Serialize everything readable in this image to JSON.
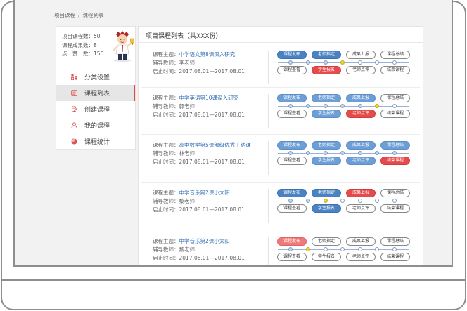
{
  "breadcrumb": [
    "项目课程",
    "课程列表"
  ],
  "stats": {
    "project_courses": "项目课程数：50",
    "results": "课程成果数：8",
    "likes": "点　赞　数：156"
  },
  "menu": [
    {
      "label": "分类设置",
      "icon": "category-icon",
      "active": false
    },
    {
      "label": "课程列表",
      "icon": "list-icon",
      "active": true
    },
    {
      "label": "创建课程",
      "icon": "create-icon",
      "active": false
    },
    {
      "label": "我的课程",
      "icon": "user-icon",
      "active": false
    },
    {
      "label": "课程统计",
      "icon": "pie-chart-icon",
      "active": false
    }
  ],
  "panel_title": "项目课程列表（共XXX份）",
  "labels": {
    "topic": "课程主题：",
    "teacher": "辅导教师：",
    "time": "启止时间："
  },
  "courses": [
    {
      "topic": "中学语文第8课深入研究",
      "teacher": "李老师",
      "time": "2017.08.01—2017.08.01",
      "top": [
        {
          "label": "课程发布",
          "style": "blue"
        },
        {
          "label": "老师指定",
          "style": "blue"
        },
        {
          "label": "成果上报",
          "style": "white"
        },
        {
          "label": "课程总结",
          "style": "white"
        }
      ],
      "bottom": [
        {
          "label": "课程查看",
          "style": "white"
        },
        {
          "label": "学生报名",
          "style": "red"
        },
        {
          "label": "老师点评",
          "style": "white"
        },
        {
          "label": "结束课程",
          "style": "white"
        }
      ],
      "current": 3
    },
    {
      "topic": "中学英语第10课深入研究",
      "teacher": "郭老师",
      "time": "2017.08.01—2017.08.01",
      "top": [
        {
          "label": "课程发布",
          "style": "lightblue"
        },
        {
          "label": "老师指定",
          "style": "lightblue"
        },
        {
          "label": "成果上报",
          "style": "lightblue"
        },
        {
          "label": "课程总结",
          "style": "white"
        }
      ],
      "bottom": [
        {
          "label": "课程查看",
          "style": "white"
        },
        {
          "label": "学生报名",
          "style": "lightblue"
        },
        {
          "label": "老师点评",
          "style": "red"
        },
        {
          "label": "结束课程",
          "style": "white"
        }
      ],
      "current": 5
    },
    {
      "topic": "高中数学第5课部级优秀王纳谦",
      "teacher": "林老师",
      "time": "2017.08.01—2017.08.01",
      "top": [
        {
          "label": "课程发布",
          "style": "lightblue"
        },
        {
          "label": "老师指定",
          "style": "lightblue"
        },
        {
          "label": "成果上报",
          "style": "lightblue"
        },
        {
          "label": "课程总结",
          "style": "lightblue"
        }
      ],
      "bottom": [
        {
          "label": "课程查看",
          "style": "white"
        },
        {
          "label": "学生报名",
          "style": "lightblue"
        },
        {
          "label": "老师点评",
          "style": "lightblue"
        },
        {
          "label": "结束课程",
          "style": "red"
        }
      ],
      "current": 7
    },
    {
      "topic": "中学音乐第2课小太阳",
      "teacher": "黎老师",
      "time": "2017.08.01—2017.08.01",
      "top": [
        {
          "label": "课程发布",
          "style": "blue"
        },
        {
          "label": "老师指定",
          "style": "blue"
        },
        {
          "label": "成果上报",
          "style": "red"
        },
        {
          "label": "课程总结",
          "style": "white"
        }
      ],
      "bottom": [
        {
          "label": "课程查看",
          "style": "white"
        },
        {
          "label": "学生报名",
          "style": "blue"
        },
        {
          "label": "老师点评",
          "style": "white"
        },
        {
          "label": "结束课程",
          "style": "white"
        }
      ],
      "current": 2
    },
    {
      "topic": "中学音乐第2课小太阳",
      "teacher": "黎老师",
      "time": "2017.08.01—2017.08.01",
      "top": [
        {
          "label": "课程发布",
          "style": "lightred"
        },
        {
          "label": "老师指定",
          "style": "white"
        },
        {
          "label": "成果上报",
          "style": "white"
        },
        {
          "label": "课程总结",
          "style": "white"
        }
      ],
      "bottom": [
        {
          "label": "课程查看",
          "style": "white"
        },
        {
          "label": "学生报名",
          "style": "white"
        },
        {
          "label": "老师点评",
          "style": "white"
        },
        {
          "label": "结束课程",
          "style": "white"
        }
      ],
      "current": 1
    }
  ],
  "colors": {
    "accent_blue": "#4a82c3",
    "accent_red": "#e54b4b",
    "current_step": "#f0d43a",
    "link": "#2f6eb5"
  }
}
